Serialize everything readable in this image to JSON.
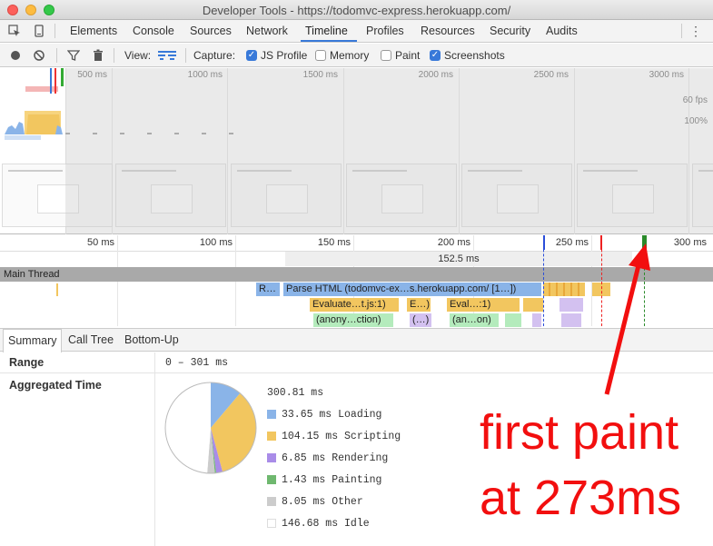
{
  "window": {
    "title": "Developer Tools - https://todomvc-express.herokuapp.com/"
  },
  "tabs": [
    "Elements",
    "Console",
    "Sources",
    "Network",
    "Timeline",
    "Profiles",
    "Resources",
    "Security",
    "Audits"
  ],
  "active_tab": "Timeline",
  "toolbar": {
    "view_label": "View:",
    "capture_label": "Capture:",
    "js_profile": "JS Profile",
    "memory": "Memory",
    "paint": "Paint",
    "screenshots": "Screenshots"
  },
  "overview": {
    "ticks": [
      "500 ms",
      "1000 ms",
      "1500 ms",
      "2000 ms",
      "2500 ms",
      "3000 ms"
    ],
    "fps_label": "60 fps",
    "cpu_label": "100%"
  },
  "ruler": {
    "ticks": [
      "50 ms",
      "100 ms",
      "150 ms",
      "200 ms",
      "250 ms",
      "300 ms"
    ],
    "duration": "152.5 ms"
  },
  "flame": {
    "main_thread": "Main Thread",
    "r": "R…",
    "parse_html": "Parse HTML (todomvc-ex…s.herokuapp.com/ [1…])",
    "evaluate1": "Evaluate…t.js:1)",
    "evaluate2": "E…)",
    "evaluate3": "Eval…:1)",
    "anon1": "(anony…ction)",
    "anon2": "(…)",
    "anon3": "(an…on)"
  },
  "details": {
    "tabs": [
      "Summary",
      "Call Tree",
      "Bottom-Up"
    ],
    "range_label": "Range",
    "range_value": "0 – 301 ms",
    "aggregated_label": "Aggregated Time",
    "total": "300.81 ms",
    "legend": [
      {
        "label": "33.65 ms Loading",
        "color": "#8ab4e8"
      },
      {
        "label": "104.15 ms Scripting",
        "color": "#f2c65f"
      },
      {
        "label": "6.85 ms Rendering",
        "color": "#a98ce8"
      },
      {
        "label": "1.43 ms Painting",
        "color": "#6fb86f"
      },
      {
        "label": "8.05 ms Other",
        "color": "#cccccc"
      },
      {
        "label": "146.68 ms Idle",
        "color": "#ffffff"
      }
    ],
    "pie_values": [
      33.65,
      104.15,
      6.85,
      1.43,
      8.05,
      146.68
    ]
  },
  "annotation": {
    "line1": "first paint",
    "line2": "at 273ms",
    "color": "#f20f0f"
  }
}
